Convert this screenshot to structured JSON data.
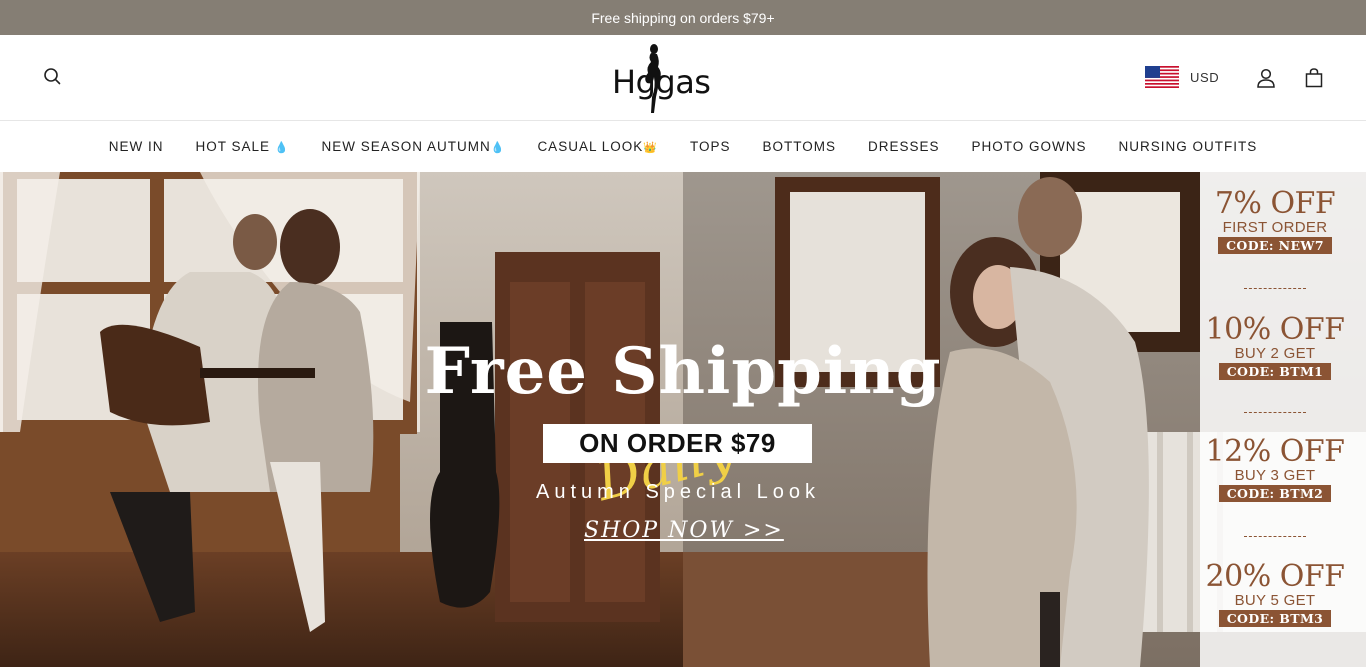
{
  "announcement": {
    "text": "Free shipping on orders $79+"
  },
  "header": {
    "logo_text": "Hggas",
    "currency": "USD"
  },
  "nav": {
    "items": [
      {
        "label": "NEW IN",
        "emoji": ""
      },
      {
        "label": "HOT SALE",
        "emoji": "💧"
      },
      {
        "label": "NEW SEASON AUTUMN",
        "emoji": "💧"
      },
      {
        "label": "CASUAL LOOK",
        "emoji": "👑"
      },
      {
        "label": "TOPS",
        "emoji": ""
      },
      {
        "label": "BOTTOMS",
        "emoji": ""
      },
      {
        "label": "DRESSES",
        "emoji": ""
      },
      {
        "label": "PHOTO GOWNS",
        "emoji": ""
      },
      {
        "label": "NURSING OUTFITS",
        "emoji": ""
      }
    ]
  },
  "hero": {
    "script_text": "Daily",
    "title": "Free Shipping",
    "badge": "ON ORDER $79",
    "subtitle": "Autumn Special Look",
    "cta": "SHOP NOW >>"
  },
  "promos": [
    {
      "off": "7% OFF",
      "desc": "FIRST ORDER",
      "code": "CODE: NEW7"
    },
    {
      "off": "10% OFF",
      "desc": "BUY 2 GET",
      "code": "CODE: BTM1"
    },
    {
      "off": "12% OFF",
      "desc": "BUY 3 GET",
      "code": "CODE: BTM2"
    },
    {
      "off": "20% OFF",
      "desc": "BUY 5 GET",
      "code": "CODE: BTM3"
    }
  ],
  "colors": {
    "announcement_bg": "#857e74",
    "promo_brown": "#8b5434",
    "script_yellow": "#f0cf46"
  },
  "icons": [
    "search-icon",
    "logo-silhouette-icon",
    "us-flag-icon",
    "account-icon",
    "cart-icon"
  ]
}
